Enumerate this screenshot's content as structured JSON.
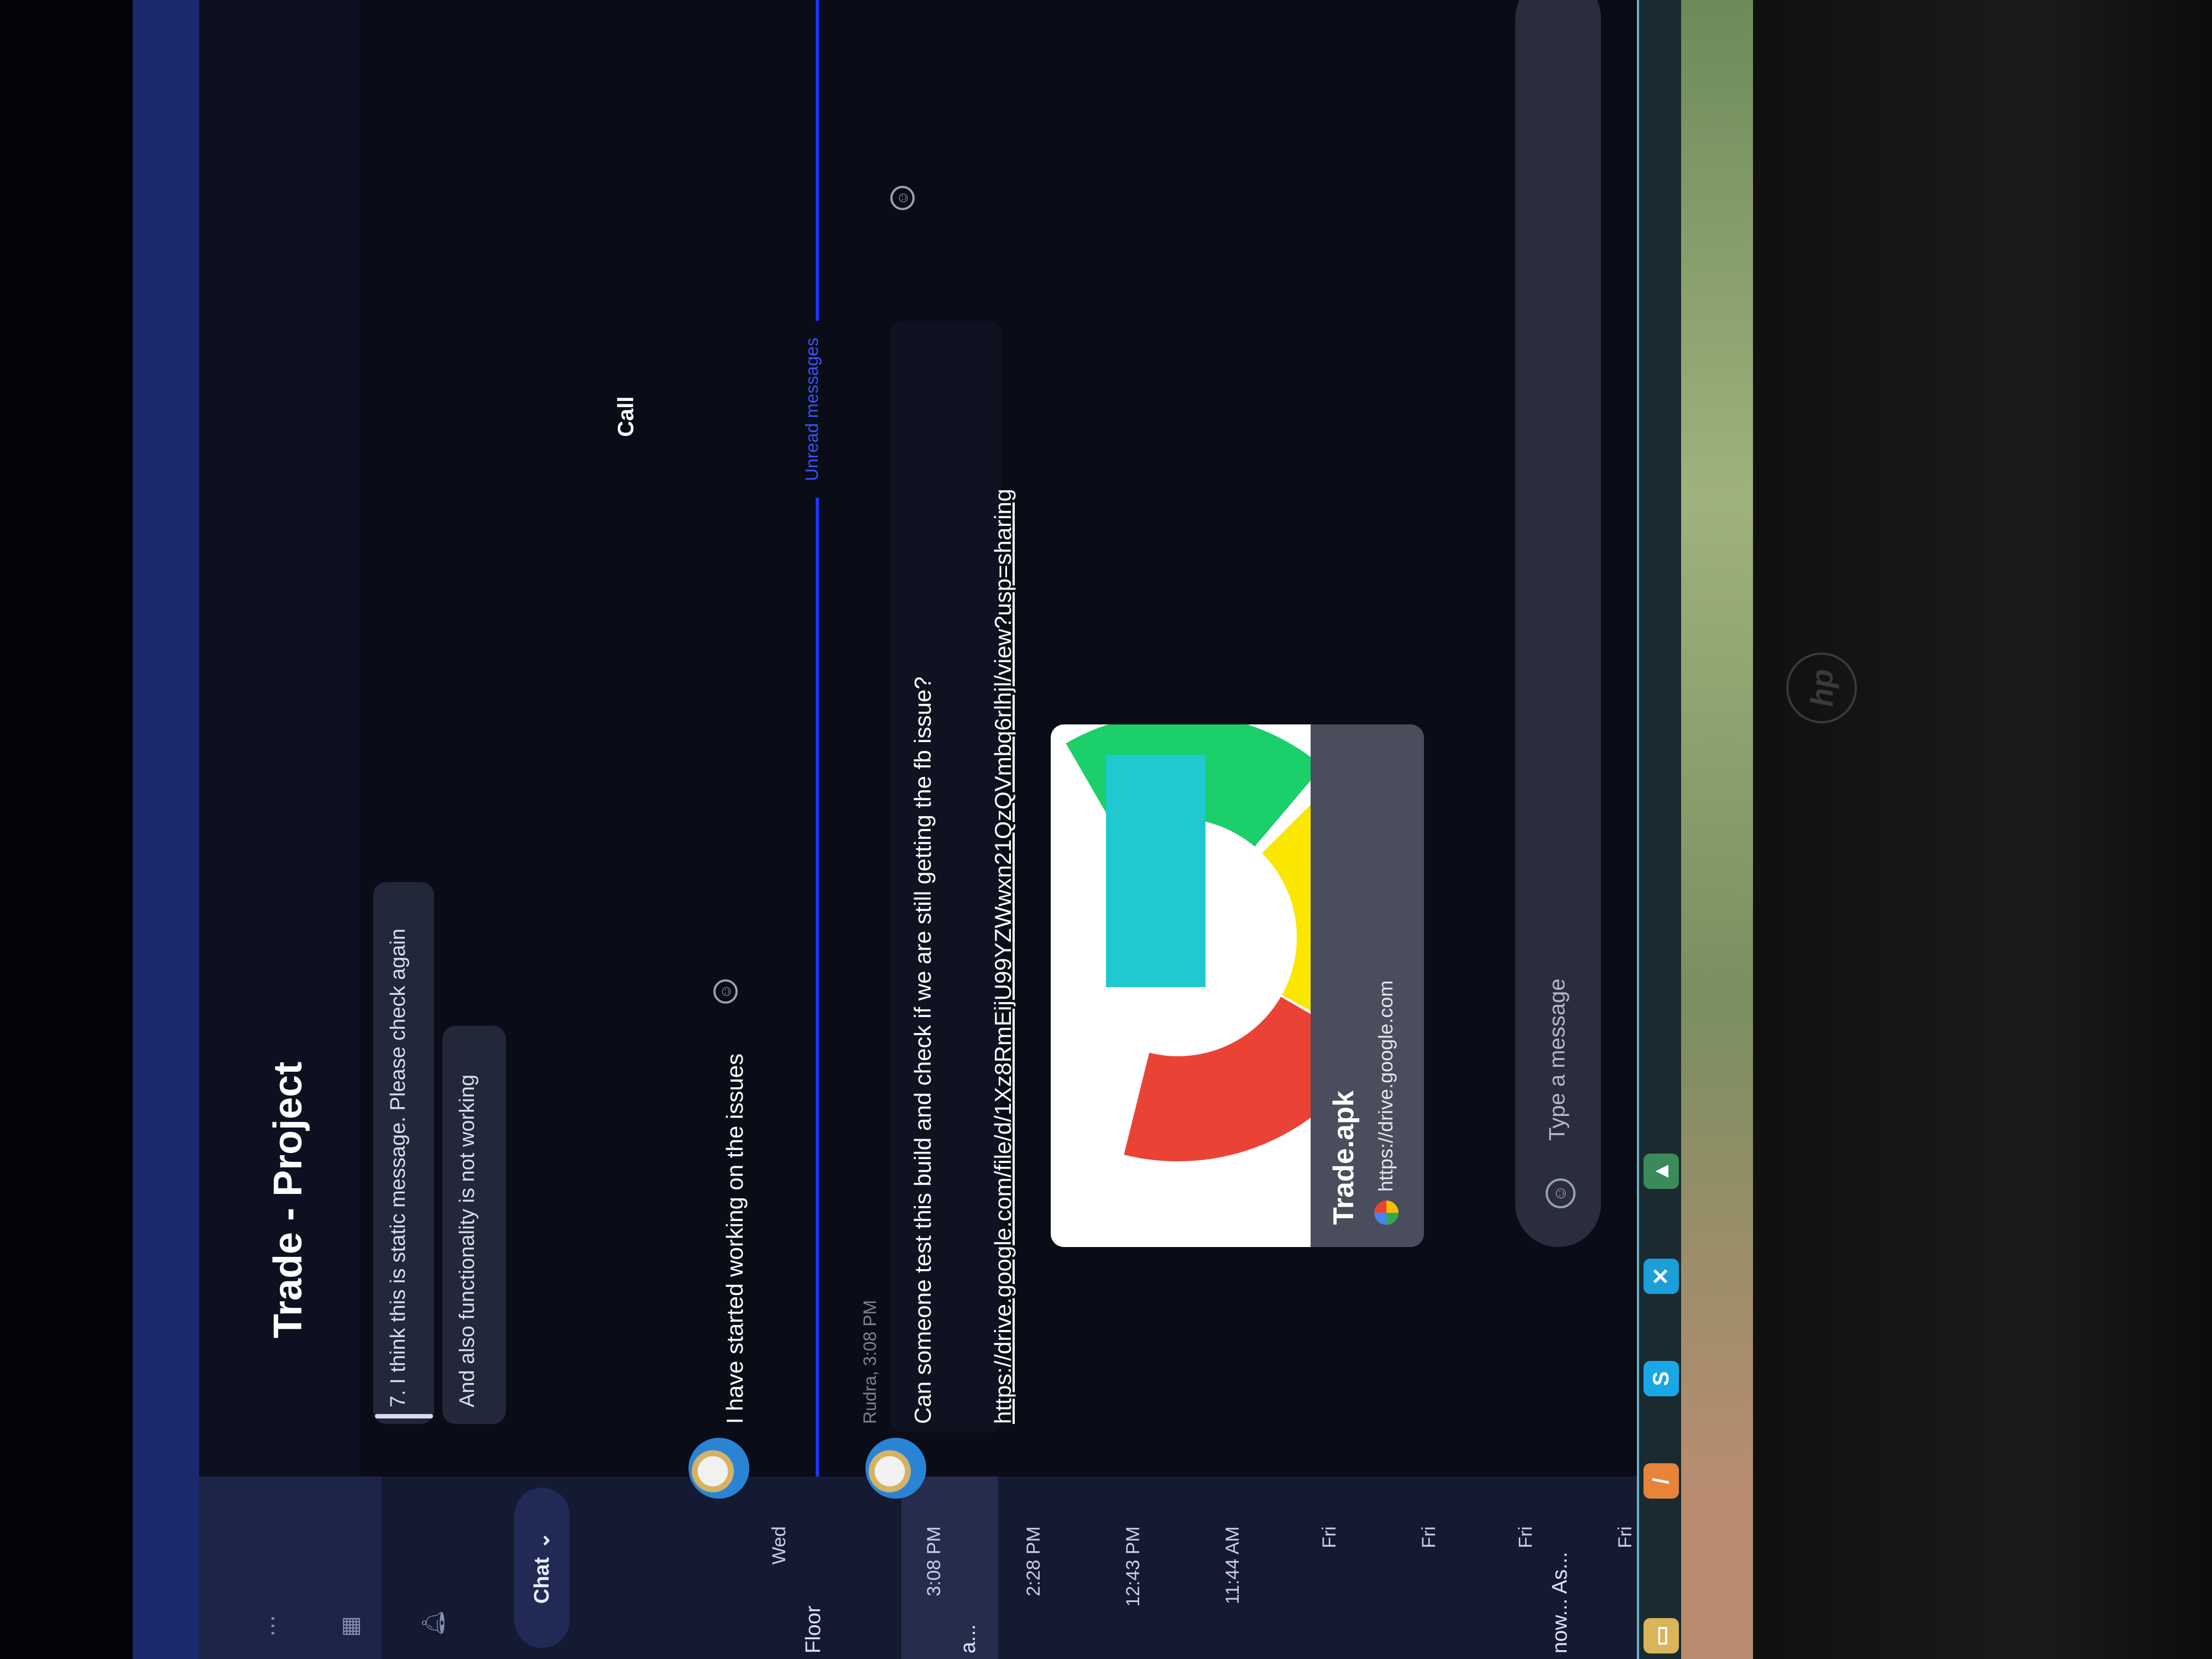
{
  "colors": {
    "accent": "#1f36ff",
    "sidebar_bg": "#151a33",
    "main_bg": "#0a0c17",
    "bubble_bg": "#22273a",
    "card_bg": "#4a4d5b"
  },
  "device": {
    "logo_text": "hp"
  },
  "header": {
    "title": "Trade - Project"
  },
  "sidebar": {
    "more_icon": "more-dots-icon",
    "grid_icon": "grid-icon",
    "bell_icon": "bell-icon",
    "new_chat_label": "Chat",
    "items": [
      {
        "name": "Floor",
        "time": "Wed"
      },
      {
        "name": "a...",
        "time": "3:08 PM",
        "selected": true
      },
      {
        "name": "",
        "time": "2:28 PM"
      },
      {
        "name": "",
        "time": "12:43 PM"
      },
      {
        "name": "",
        "time": "11:44 AM"
      },
      {
        "name": "",
        "time": "Fri"
      },
      {
        "name": "",
        "time": "Fri"
      },
      {
        "name": "now... As...",
        "time": "Fri"
      },
      {
        "name": "",
        "time": "Fri"
      }
    ]
  },
  "messages": {
    "bubble1": "7. I think this is static message. Please check again",
    "bubble2": "And also functionality is not working",
    "call_label": "Call",
    "msg1_text": "I have started working on the issues",
    "unread_label": "Unread messages",
    "msg2_meta": "Rudra, 3:08 PM",
    "msg2_text": "Can someone test this build and check if we are still getting the fb issue?",
    "msg2_link": "https://drive.google.com/file/d/1Xz8RmEijU99YZWwxn21QzQVmbq6rlhjl/view?usp=sharing",
    "card": {
      "title": "Trade.apk",
      "url": "https://drive.google.com"
    }
  },
  "composer": {
    "placeholder": "Type a message"
  },
  "taskbar": {
    "icons": [
      "file-explorer-icon",
      "sublime-icon",
      "skype-icon",
      "vscode-icon",
      "android-studio-icon"
    ]
  }
}
